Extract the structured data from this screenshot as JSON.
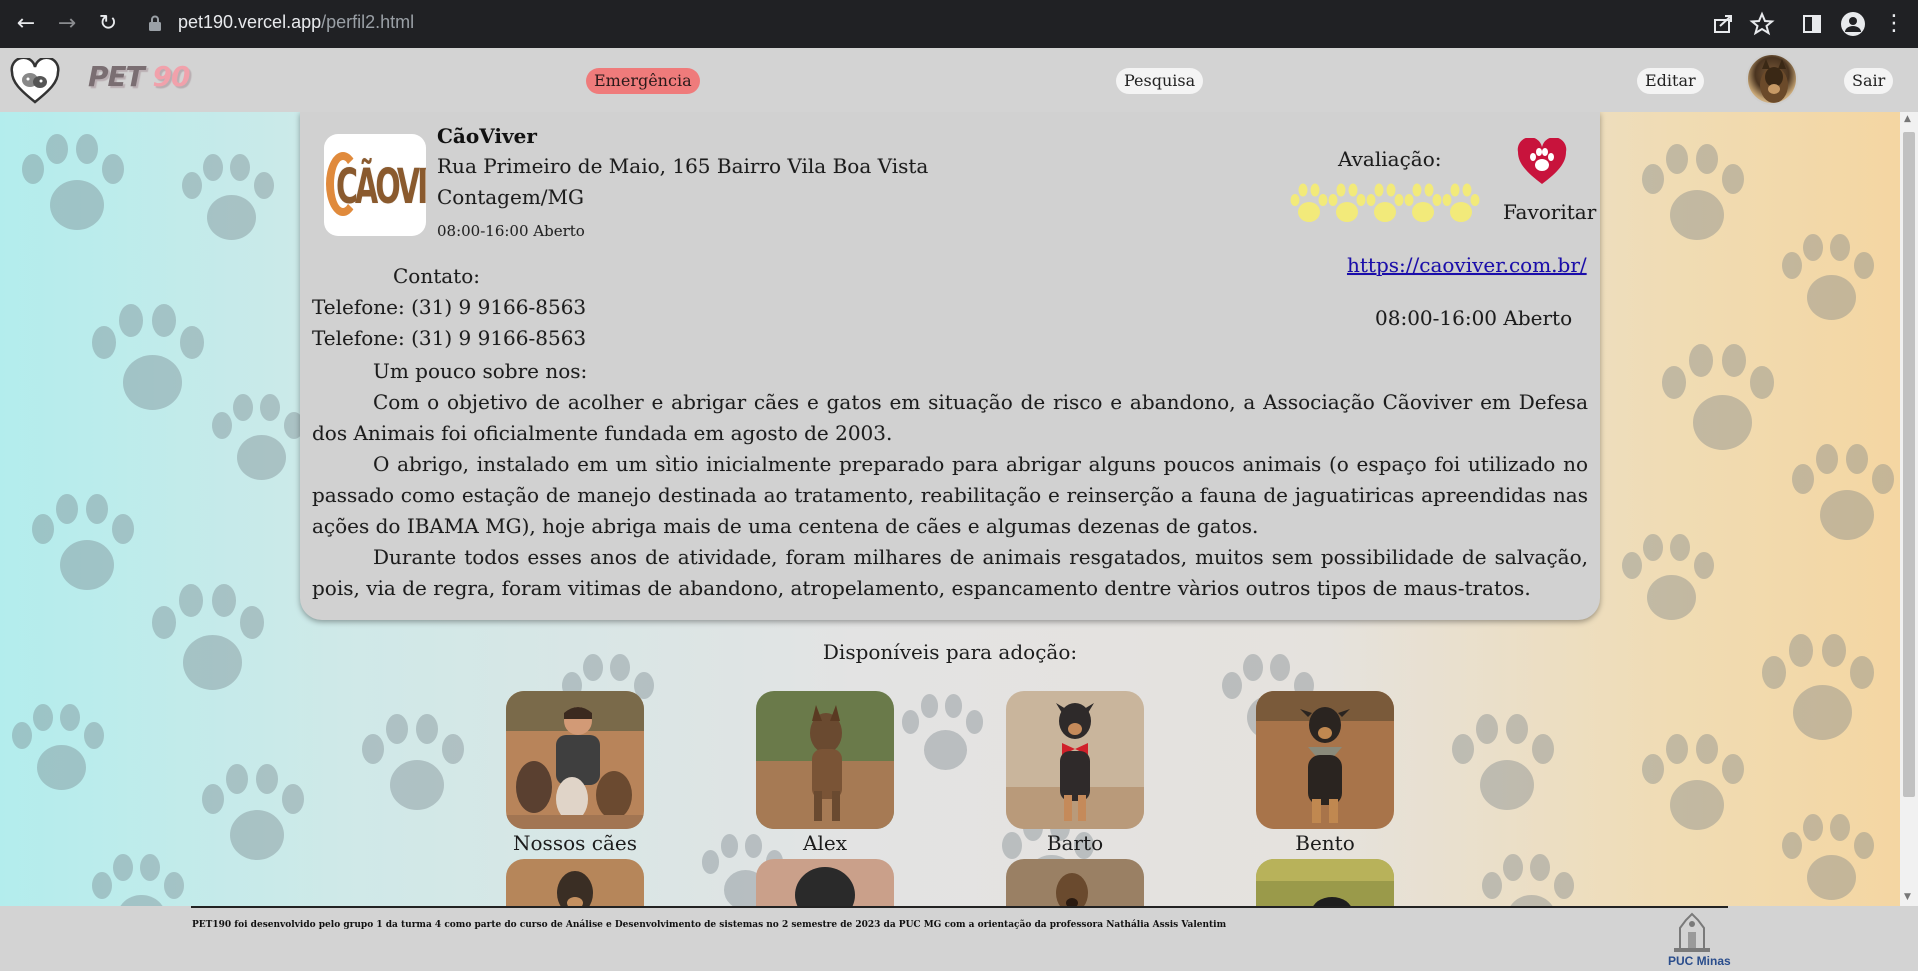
{
  "browser": {
    "url_host": "pet190.vercel.app",
    "url_path": "/perfil2.html"
  },
  "header": {
    "brand_left": "PET",
    "brand_right": "90",
    "emergency_label": "Emergência",
    "search_label": "Pesquisa",
    "edit_label": "Editar",
    "logout_label": "Sair"
  },
  "profile": {
    "name": "CãoViver",
    "logo_text": "CÃOVIVER",
    "address_line1": "Rua Primeiro de Maio, 165 Bairro Vila Boa Vista",
    "address_line2": "Contagem/MG",
    "hours_small": "08:00-16:00 Aberto",
    "contact_title": "Contato:",
    "phones": [
      "Telefone: (31) 9 9166-8563",
      "Telefone: (31) 9 9166-8563"
    ],
    "rating_label": "Avaliação:",
    "rating_value": 5,
    "rating_max": 5,
    "favorite_label": "Favoritar",
    "website": "https://caoviver.com.br/",
    "hours": "08:00-16:00 Aberto",
    "about_title": "Um pouco sobre nos:",
    "about_paragraphs": [
      "Com o objetivo de acolher e abrigar cães e gatos em situação de risco e abandono, a Associação Cãoviver em Defesa dos Animais foi oficialmente fundada em agosto de 2003.",
      "O abrigo, instalado em um sìtio inicialmente preparado para abrigar alguns poucos animais (o espaço foi utilizado no passado como estação de manejo destinada ao tratamento, reabilitação e reinserção a fauna de jaguatiricas apreendidas nas ações do IBAMA MG), hoje abriga mais de uma centena de cães e algumas dezenas de gatos.",
      "Durante todos esses anos de atividade, foram milhares de animais resgatados, muitos sem possibilidade de salvação, pois, via de regra, foram vitimas de abandono, atropelamento, espancamento dentre vàrios outros tipos de maus-tratos."
    ]
  },
  "adoption": {
    "title": "Disponíveis para adoção:",
    "pets": [
      {
        "name": "Nossos cães"
      },
      {
        "name": "Alex"
      },
      {
        "name": "Barto"
      },
      {
        "name": "Bento"
      }
    ]
  },
  "footer": {
    "text": "PET190 foi desenvolvido pelo grupo 1 da turma 4 como parte do curso de Análise e Desenvolvimento de sistemas no 2 semestre de 2023 da PUC MG com a orientação da professora Nathália Assis Valentim",
    "puc_label": "PUC Minas"
  },
  "colors": {
    "emergency": "#ef7b7b",
    "link": "#1a0dab",
    "rating_paw": "#f2ea7a",
    "favorite_heart": "#c8133c"
  }
}
